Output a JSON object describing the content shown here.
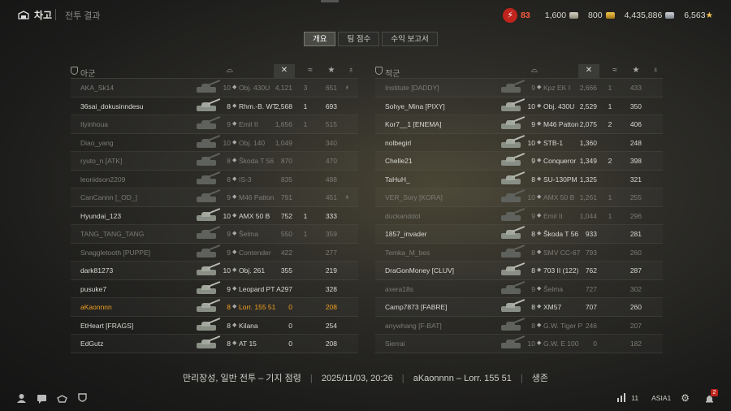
{
  "header": {
    "garage_label": "차고",
    "breadcrumb": "전투 결과",
    "resources": {
      "bonds_count": "83",
      "credits_free": "1,600",
      "gold": "800",
      "credits": "4,435,886",
      "free_xp": "6,563"
    }
  },
  "tabs": [
    {
      "label": "개요",
      "active": true
    },
    {
      "label": "팀 점수",
      "active": false
    },
    {
      "label": "수익 보고서",
      "active": false
    }
  ],
  "ally": {
    "title": "아군",
    "rows": [
      {
        "player": "AKA_Sk14",
        "tier": "10",
        "tank": "Obj. 430U",
        "v1": "4,121",
        "v2": "3",
        "v3": "651",
        "dead": true,
        "medal": true
      },
      {
        "player": "36sai_dokusinndesu",
        "tier": "8",
        "tank": "Rhm.-B. WT",
        "v1": "2,568",
        "v2": "1",
        "v3": "693",
        "dead": false
      },
      {
        "player": "Ilyinhoua",
        "tier": "9",
        "tank": "Emil II",
        "v1": "1,656",
        "v2": "1",
        "v3": "515",
        "dead": true
      },
      {
        "player": "Diao_yang",
        "tier": "10",
        "tank": "Obj. 140",
        "v1": "1,049",
        "v2": "",
        "v3": "340",
        "dead": true
      },
      {
        "player": "ryuto_n [ATK]",
        "tier": "8",
        "tank": "Škoda T 56",
        "v1": "870",
        "v2": "",
        "v3": "470",
        "dead": true
      },
      {
        "player": "leonidson2209",
        "tier": "8",
        "tank": "IS-3",
        "v1": "835",
        "v2": "",
        "v3": "488",
        "dead": true
      },
      {
        "player": "CanCannn [_OD_]",
        "tier": "9",
        "tank": "M46 Patton",
        "v1": "791",
        "v2": "",
        "v3": "451",
        "dead": true,
        "medal": true
      },
      {
        "player": "Hyundai_123",
        "tier": "10",
        "tank": "AMX 50 B",
        "v1": "752",
        "v2": "1",
        "v3": "333",
        "dead": false
      },
      {
        "player": "TANG_TANG_TANG",
        "tier": "9",
        "tank": "Šelma",
        "v1": "550",
        "v2": "1",
        "v3": "359",
        "dead": true
      },
      {
        "player": "Snaggletooth [PUPPE]",
        "tier": "9",
        "tank": "Contender",
        "v1": "422",
        "v2": "",
        "v3": "277",
        "dead": true
      },
      {
        "player": "dark81273",
        "tier": "10",
        "tank": "Obj. 261",
        "v1": "355",
        "v2": "",
        "v3": "219",
        "dead": false
      },
      {
        "player": "pusuke7",
        "tier": "9",
        "tank": "Leopard PT A",
        "v1": "297",
        "v2": "",
        "v3": "328",
        "dead": false
      },
      {
        "player": "aKaonnnn",
        "tier": "8",
        "tank": "Lorr. 155 51",
        "v1": "0",
        "v2": "",
        "v3": "208",
        "dead": false,
        "self": true
      },
      {
        "player": "EtHeart [FRAGS]",
        "tier": "8",
        "tank": "Kilana",
        "v1": "0",
        "v2": "",
        "v3": "254",
        "dead": false
      },
      {
        "player": "EdGutz",
        "tier": "8",
        "tank": "AT 15",
        "v1": "0",
        "v2": "",
        "v3": "208",
        "dead": false
      }
    ]
  },
  "enemy": {
    "title": "적군",
    "rows": [
      {
        "player": "Institute [DADDY]",
        "tier": "9",
        "tank": "Kpz EK I",
        "v1": "2,666",
        "v2": "1",
        "v3": "433",
        "dead": true
      },
      {
        "player": "Sohye_Mina [PIXY]",
        "tier": "10",
        "tank": "Obj. 430U",
        "v1": "2,529",
        "v2": "1",
        "v3": "350",
        "dead": false
      },
      {
        "player": "Kor7__1 [ENEMA]",
        "tier": "9",
        "tank": "M46 Patton",
        "v1": "2,075",
        "v2": "2",
        "v3": "406",
        "dead": false
      },
      {
        "player": "nolbegirl",
        "tier": "10",
        "tank": "STB-1",
        "v1": "1,360",
        "v2": "",
        "v3": "248",
        "dead": false
      },
      {
        "player": "Chelle21",
        "tier": "9",
        "tank": "Conqueror",
        "v1": "1,349",
        "v2": "2",
        "v3": "398",
        "dead": false
      },
      {
        "player": "TaHuH_",
        "tier": "8",
        "tank": "SU-130PM",
        "v1": "1,325",
        "v2": "",
        "v3": "321",
        "dead": false
      },
      {
        "player": "VER_Sory [KORA]",
        "tier": "10",
        "tank": "AMX 50 B",
        "v1": "1,261",
        "v2": "1",
        "v3": "255",
        "dead": true
      },
      {
        "player": "duckanddol",
        "tier": "9",
        "tank": "Emil II",
        "v1": "1,044",
        "v2": "1",
        "v3": "296",
        "dead": true
      },
      {
        "player": "1857_invader",
        "tier": "8",
        "tank": "Škoda T 56",
        "v1": "933",
        "v2": "",
        "v3": "281",
        "dead": false
      },
      {
        "player": "Temka_M_bes",
        "tier": "8",
        "tank": "SMV CC-67",
        "v1": "793",
        "v2": "",
        "v3": "260",
        "dead": true
      },
      {
        "player": "DraGonMoney [CLUV]",
        "tier": "8",
        "tank": "703 II (122)",
        "v1": "762",
        "v2": "",
        "v3": "287",
        "dead": false
      },
      {
        "player": "axera18s",
        "tier": "9",
        "tank": "Šelma",
        "v1": "727",
        "v2": "",
        "v3": "302",
        "dead": true
      },
      {
        "player": "Camp7873 [FABRE]",
        "tier": "8",
        "tank": "XM57",
        "v1": "707",
        "v2": "",
        "v3": "260",
        "dead": false
      },
      {
        "player": "anywhang [F-BAT]",
        "tier": "8",
        "tank": "G.W. Tiger P",
        "v1": "246",
        "v2": "",
        "v3": "207",
        "dead": true
      },
      {
        "player": "Sierrai",
        "tier": "10",
        "tank": "G.W. E 100",
        "v1": "0",
        "v2": "",
        "v3": "182",
        "dead": true
      }
    ]
  },
  "summary": {
    "mode": "만리장성, 일반 전투 – 기지 점령",
    "datetime": "2025/11/03, 20:26",
    "player_tank": "aKaonnnn – Lorr. 155 51",
    "result": "생존"
  },
  "footer": {
    "online_count": "11",
    "server": "ASIA1",
    "notifications": "2"
  }
}
